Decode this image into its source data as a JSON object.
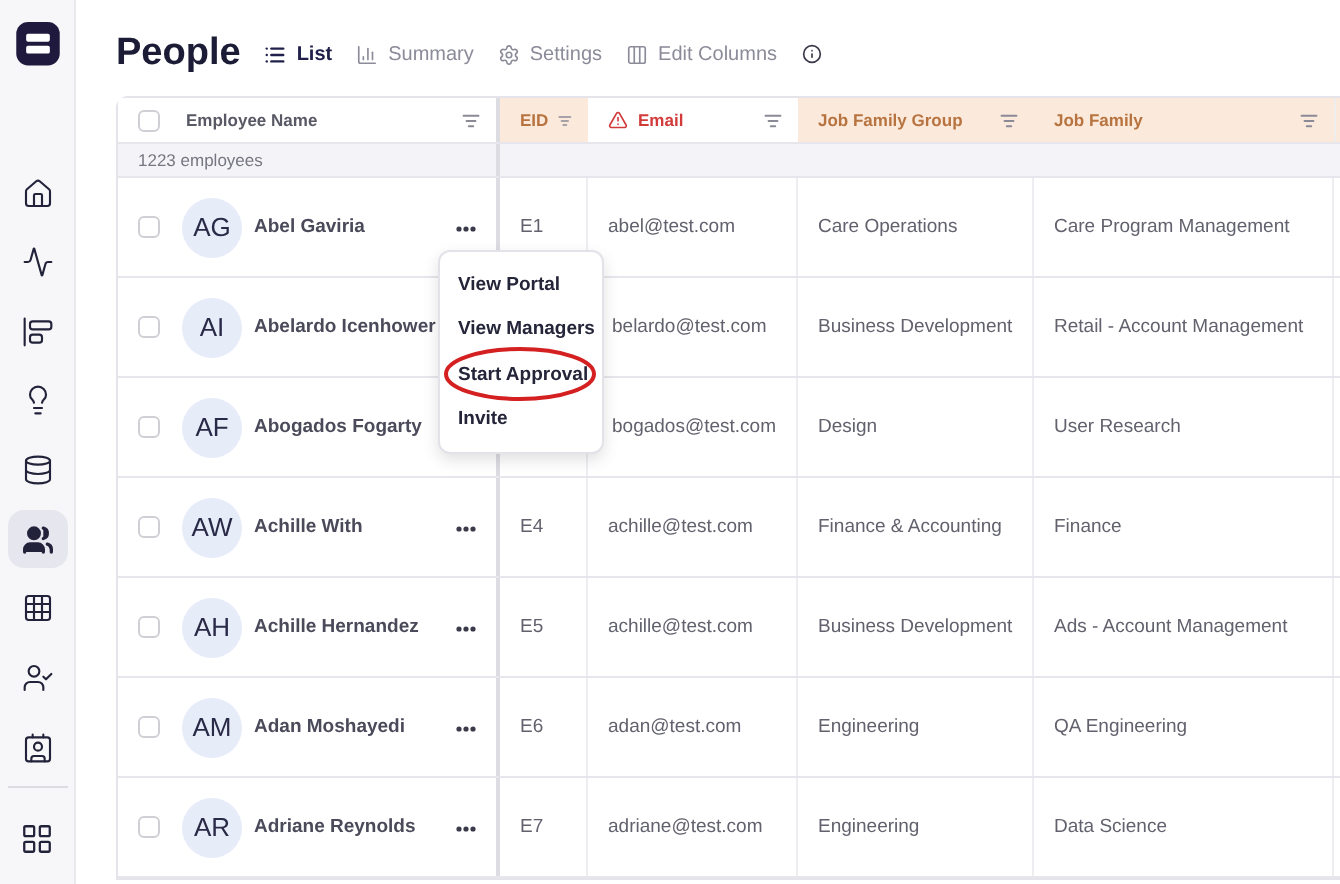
{
  "sidebar": {
    "items": [
      {
        "selected": false
      },
      {
        "selected": false
      },
      {
        "selected": false
      },
      {
        "selected": false
      },
      {
        "selected": false
      },
      {
        "selected": true
      },
      {
        "selected": false
      },
      {
        "selected": false
      },
      {
        "selected": false
      }
    ]
  },
  "page": {
    "title": "People",
    "views": [
      {
        "label": "List",
        "selected": true
      },
      {
        "label": "Summary",
        "selected": false
      },
      {
        "label": "Settings",
        "selected": false
      },
      {
        "label": "Edit Columns",
        "selected": false
      }
    ]
  },
  "table": {
    "all_checked": false,
    "columns": [
      {
        "label": "Employee Name",
        "kind": "plain"
      },
      {
        "label": "EID",
        "kind": "highlighted"
      },
      {
        "label": "Email",
        "kind": "warning"
      },
      {
        "label": "Job Family Group",
        "kind": "highlighted"
      },
      {
        "label": "Job Family",
        "kind": "highlighted"
      }
    ],
    "count": "1223 employees",
    "rows": [
      {
        "checked": false,
        "initials": "AG",
        "name": "Abel Gaviria",
        "actions_visible": true,
        "eid": "E1",
        "email": "abel@test.com",
        "group": "Care Operations",
        "family": "Care Program Management"
      },
      {
        "checked": false,
        "initials": "AI",
        "name": "Abelardo Icenhower",
        "actions_visible": false,
        "email": "belardo@test.com",
        "group": "Business Development",
        "family": "Retail - Account Management"
      },
      {
        "checked": false,
        "initials": "AF",
        "name": "Abogados Fogarty",
        "actions_visible": false,
        "email": "bogados@test.com",
        "group": "Design",
        "family": "User Research"
      },
      {
        "checked": false,
        "initials": "AW",
        "name": "Achille With",
        "actions_visible": true,
        "eid": "E4",
        "email": "achille@test.com",
        "group": "Finance & Accounting",
        "family": "Finance"
      },
      {
        "checked": false,
        "initials": "AH",
        "name": "Achille Hernandez",
        "actions_visible": true,
        "eid": "E5",
        "email": "achille@test.com",
        "group": "Business Development",
        "family": "Ads - Account Management"
      },
      {
        "checked": false,
        "initials": "AM",
        "name": "Adan Moshayedi",
        "actions_visible": true,
        "eid": "E6",
        "email": "adan@test.com",
        "group": "Engineering",
        "family": "QA Engineering"
      },
      {
        "checked": false,
        "initials": "AR",
        "name": "Adriane Reynolds",
        "actions_visible": true,
        "eid": "E7",
        "email": "adriane@test.com",
        "group": "Engineering",
        "family": "Data Science"
      }
    ]
  },
  "row_menu": {
    "items": [
      {
        "label": "View Portal",
        "circled": false
      },
      {
        "label": "View Managers",
        "circled": false
      },
      {
        "label": "Start Approval",
        "circled": true
      },
      {
        "label": "Invite",
        "circled": false
      }
    ]
  }
}
